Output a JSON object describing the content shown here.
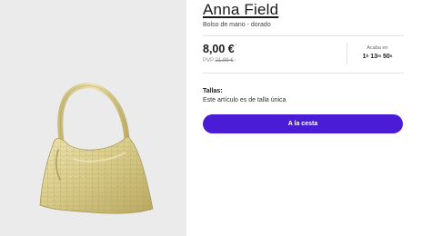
{
  "product": {
    "brand": "Anna Field",
    "description": "Bolso de mano - dorado",
    "image_icon": "gold-handbag-image"
  },
  "pricing": {
    "price": "8,00 €",
    "price_marker": "¹",
    "rrp_prefix": "PVP",
    "rrp_value": "21,99 €",
    "rrp_marker": "¹"
  },
  "countdown": {
    "label": "Acaba en",
    "hours": "1",
    "hours_unit": "h",
    "minutes": "13",
    "minutes_unit": "m",
    "seconds": "50",
    "seconds_unit": "s"
  },
  "sizes": {
    "label": "Tallas:",
    "info": "Este artículo es de talla única"
  },
  "cart": {
    "label": "A la cesta"
  },
  "colors": {
    "accent": "#4a1cd6",
    "image_background": "#ebebeb",
    "bag_gold": "#d9cc8a"
  }
}
